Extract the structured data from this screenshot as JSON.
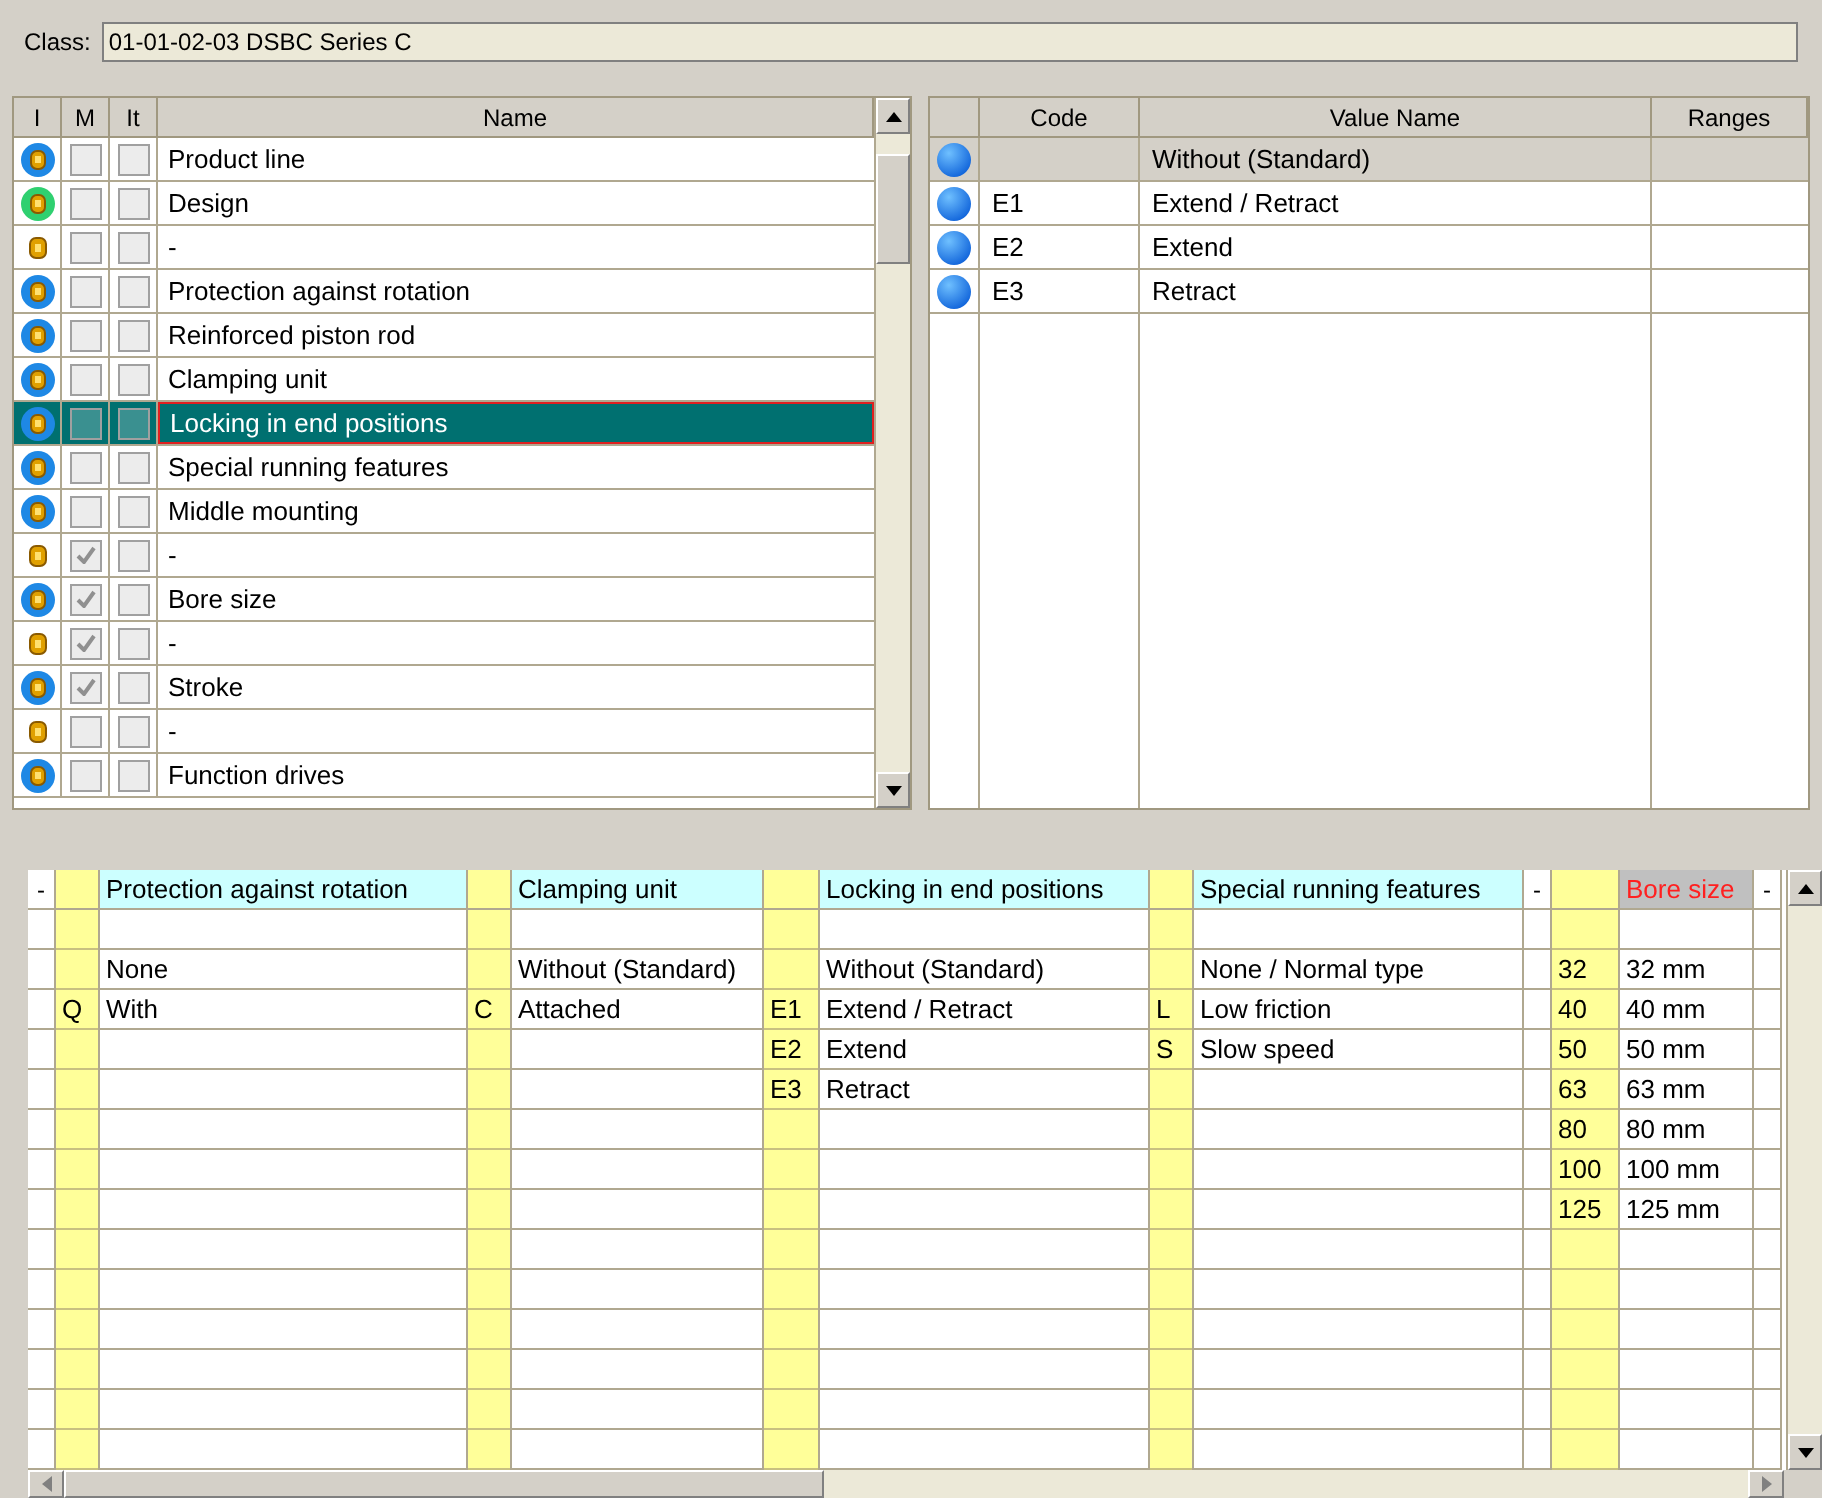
{
  "class_field": {
    "label": "Class:",
    "value": "01-01-02-03 DSBC Series C"
  },
  "features_table": {
    "columns": [
      "I",
      "M",
      "It",
      "Name"
    ],
    "rows": [
      {
        "kind": "blue",
        "m_checked": false,
        "name": "Product line",
        "selected": false
      },
      {
        "kind": "green",
        "m_checked": false,
        "name": "Design",
        "selected": false
      },
      {
        "kind": "small",
        "m_checked": false,
        "name": "-",
        "selected": false
      },
      {
        "kind": "blue",
        "m_checked": false,
        "name": "Protection against rotation",
        "selected": false
      },
      {
        "kind": "blue",
        "m_checked": false,
        "name": "Reinforced piston rod",
        "selected": false
      },
      {
        "kind": "blue",
        "m_checked": false,
        "name": "Clamping unit",
        "selected": false
      },
      {
        "kind": "blue",
        "m_checked": false,
        "name": "Locking in end positions",
        "selected": true
      },
      {
        "kind": "blue",
        "m_checked": false,
        "name": "Special running features",
        "selected": false
      },
      {
        "kind": "blue",
        "m_checked": false,
        "name": "Middle mounting",
        "selected": false
      },
      {
        "kind": "small",
        "m_checked": true,
        "name": "-",
        "selected": false
      },
      {
        "kind": "blue",
        "m_checked": true,
        "name": "Bore size",
        "selected": false
      },
      {
        "kind": "small",
        "m_checked": true,
        "name": "-",
        "selected": false
      },
      {
        "kind": "blue",
        "m_checked": true,
        "name": "Stroke",
        "selected": false
      },
      {
        "kind": "small",
        "m_checked": false,
        "name": "-",
        "selected": false
      },
      {
        "kind": "blue",
        "m_checked": false,
        "name": "Function drives",
        "selected": false
      }
    ]
  },
  "values_table": {
    "columns": [
      "Code",
      "Value Name",
      "Ranges"
    ],
    "rows": [
      {
        "name": "Without (Standard)",
        "selected": true
      },
      {
        "code": "E1",
        "name": "Extend / Retract",
        "selected": false
      },
      {
        "code": "E2",
        "name": "Extend",
        "selected": false
      },
      {
        "code": "E3",
        "name": "Retract",
        "selected": false
      }
    ]
  },
  "grid": {
    "columns": [
      {
        "kind": "dash",
        "title": "-"
      },
      {
        "kind": "feature",
        "title": "Protection against rotation",
        "selected": false,
        "values": [
          {
            "name": "None"
          },
          {
            "code": "Q",
            "name": "With"
          }
        ]
      },
      {
        "kind": "feature",
        "title": "Clamping unit",
        "selected": false,
        "values": [
          {
            "name": "Without (Standard)"
          },
          {
            "code": "C",
            "name": "Attached"
          }
        ]
      },
      {
        "kind": "feature",
        "title": "Locking in end positions",
        "selected": false,
        "values": [
          {
            "name": "Without (Standard)"
          },
          {
            "code": "E1",
            "name": "Extend / Retract"
          },
          {
            "code": "E2",
            "name": "Extend"
          },
          {
            "code": "E3",
            "name": "Retract"
          }
        ]
      },
      {
        "kind": "feature",
        "title": "Special running features",
        "selected": false,
        "values": [
          {
            "name": "None / Normal type"
          },
          {
            "code": "L",
            "name": "Low friction"
          },
          {
            "code": "S",
            "name": "Slow speed"
          }
        ]
      },
      {
        "kind": "dash",
        "title": "-"
      },
      {
        "kind": "feature",
        "title": "Bore size",
        "selected": true,
        "values": [
          {
            "code": "32",
            "name": "32 mm"
          },
          {
            "code": "40",
            "name": "40 mm"
          },
          {
            "code": "50",
            "name": "50 mm"
          },
          {
            "code": "63",
            "name": "63 mm"
          },
          {
            "code": "80",
            "name": "80 mm"
          },
          {
            "code": "100",
            "name": "100 mm"
          },
          {
            "code": "125",
            "name": "125 mm"
          }
        ]
      },
      {
        "kind": "dash",
        "title": "-"
      }
    ]
  }
}
